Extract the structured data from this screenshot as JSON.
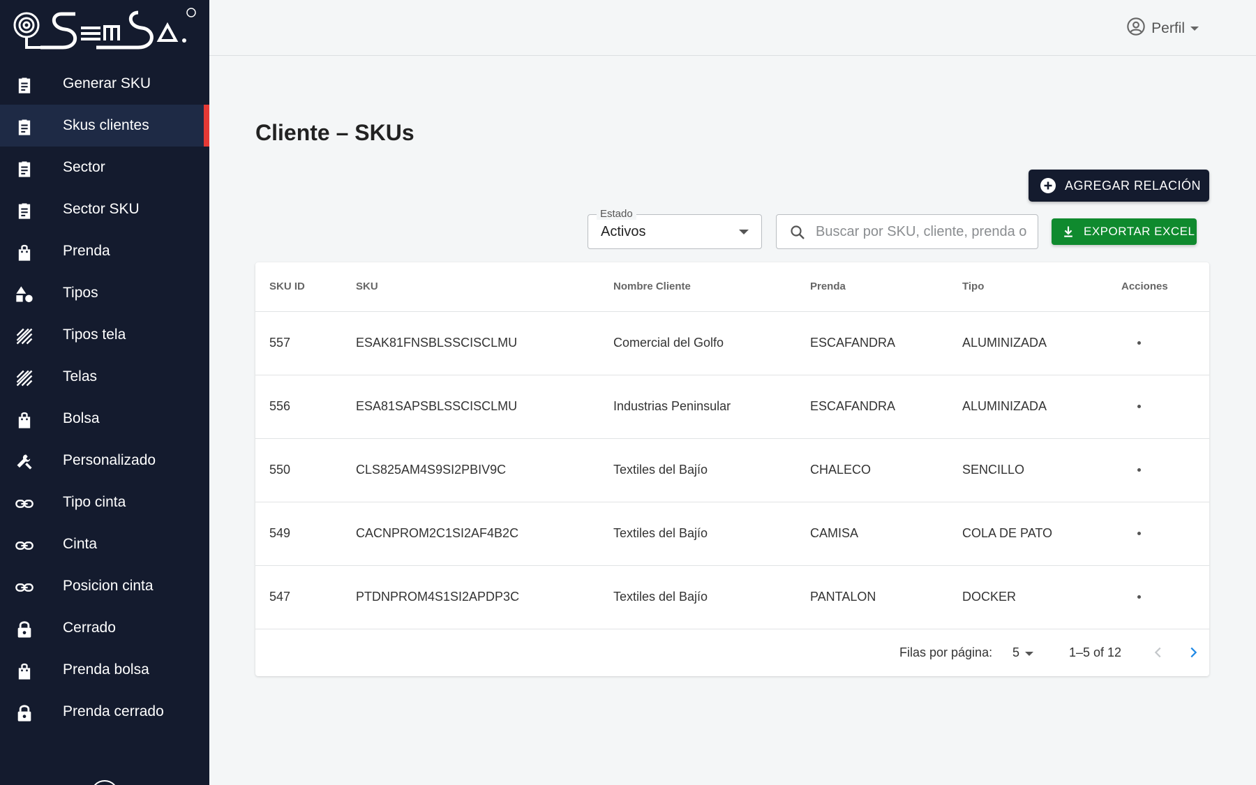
{
  "brand": {
    "name": "Semsa"
  },
  "sidebar": {
    "items": [
      {
        "label": "Generar SKU",
        "icon": "clipboard-icon"
      },
      {
        "label": "Skus clientes",
        "icon": "clipboard-icon",
        "active": true
      },
      {
        "label": "Sector",
        "icon": "clipboard-icon"
      },
      {
        "label": "Sector SKU",
        "icon": "clipboard-icon"
      },
      {
        "label": "Prenda",
        "icon": "shopping-bag-icon"
      },
      {
        "label": "Tipos",
        "icon": "shapes-icon"
      },
      {
        "label": "Tipos tela",
        "icon": "texture-icon"
      },
      {
        "label": "Telas",
        "icon": "texture-icon"
      },
      {
        "label": "Bolsa",
        "icon": "shopping-bag-icon"
      },
      {
        "label": "Personalizado",
        "icon": "wrench-icon"
      },
      {
        "label": "Tipo cinta",
        "icon": "link-icon"
      },
      {
        "label": "Cinta",
        "icon": "link-icon"
      },
      {
        "label": "Posicion cinta",
        "icon": "link-icon"
      },
      {
        "label": "Cerrado",
        "icon": "lock-icon"
      },
      {
        "label": "Prenda bolsa",
        "icon": "shopping-bag-icon"
      },
      {
        "label": "Prenda cerrado",
        "icon": "lock-icon"
      }
    ],
    "active_accent": "#e53935",
    "background": "#141b2e"
  },
  "header": {
    "profile_label": "Perfil"
  },
  "main": {
    "title": "Cliente – SKUs",
    "add_button": "AGREGAR RELACIÓN",
    "export_button": "EXPORTAR EXCEL",
    "export_color": "#0f8a2e",
    "status_filter": {
      "legend": "Estado",
      "value": "Activos"
    },
    "search": {
      "placeholder": "Buscar por SKU, cliente, prenda o tipo",
      "value": ""
    }
  },
  "table": {
    "columns": [
      "SKU ID",
      "SKU",
      "Nombre Cliente",
      "Prenda",
      "Tipo",
      "Acciones"
    ],
    "rows": [
      [
        "557",
        "ESAK81FNSBLSSCISCLMU",
        "Comercial del Golfo",
        "ESCAFANDRA",
        "ALUMINIZADA"
      ],
      [
        "556",
        "ESA81SAPSBLSSCISCLMU",
        "Industrias Peninsular",
        "ESCAFANDRA",
        "ALUMINIZADA"
      ],
      [
        "550",
        "CLS825AM4S9SI2PBIV9C",
        "Textiles del Bajío",
        "CHALECO",
        "SENCILLO"
      ],
      [
        "549",
        "CACNPROM2C1SI2AF4B2C",
        "Textiles del Bajío",
        "CAMISA",
        "COLA DE PATO"
      ],
      [
        "547",
        "PTDNPROM4S1SI2APDP3C",
        "Textiles del Bajío",
        "PANTALON",
        "DOCKER"
      ]
    ]
  },
  "pagination": {
    "rows_label": "Filas por página:",
    "rows_per_page": "5",
    "range": "1–5 of 12"
  }
}
